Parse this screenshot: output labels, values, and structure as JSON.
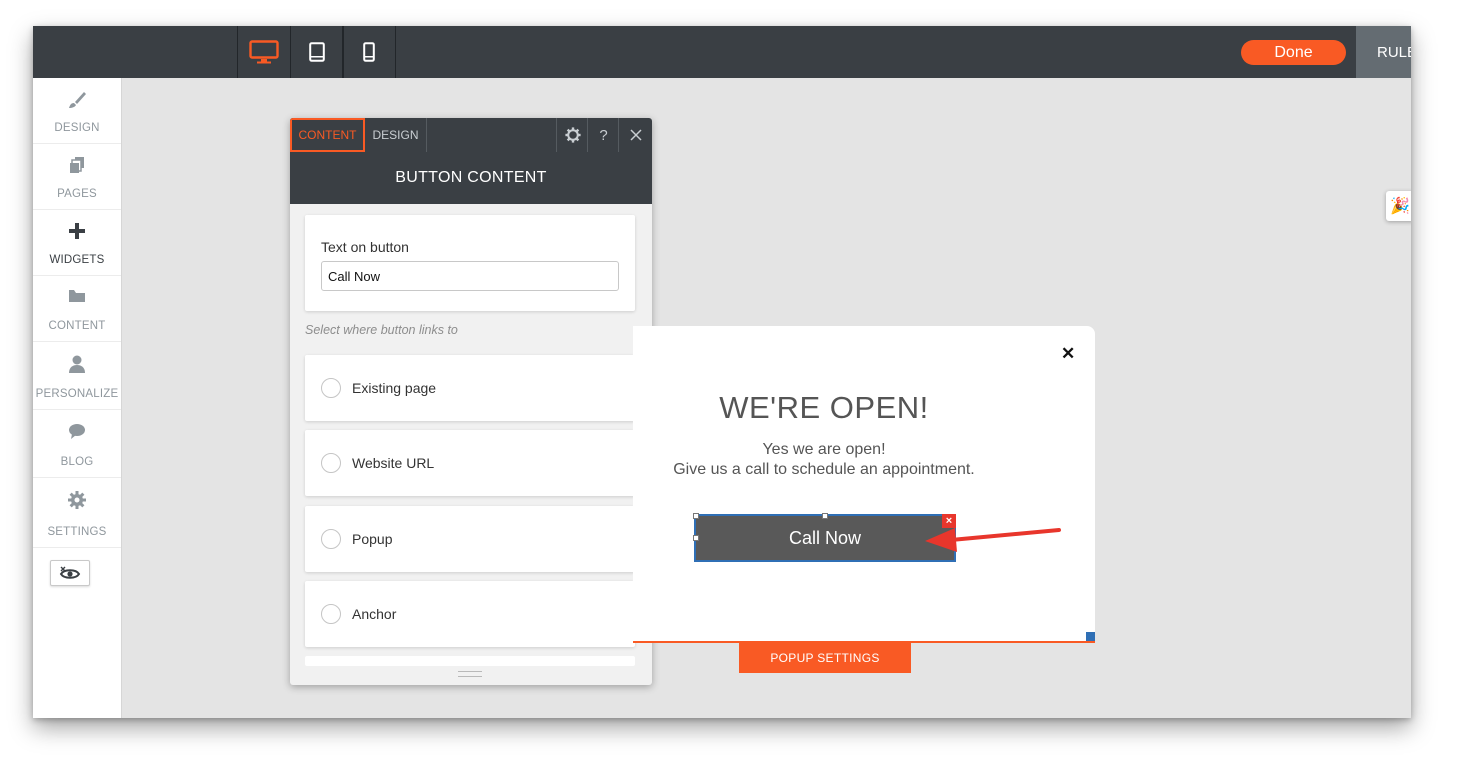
{
  "topbar": {
    "devices": [
      {
        "name": "desktop",
        "icon": "monitor-icon",
        "active": true
      },
      {
        "name": "tablet",
        "icon": "tablet-icon",
        "active": false
      },
      {
        "name": "mobile",
        "icon": "phone-icon",
        "active": false
      }
    ],
    "done_label": "Done",
    "rules_label": "RULE"
  },
  "sidebar": {
    "items": [
      {
        "label": "DESIGN",
        "icon": "brush-icon"
      },
      {
        "label": "PAGES",
        "icon": "pages-icon"
      },
      {
        "label": "WIDGETS",
        "icon": "plus-icon",
        "active": true
      },
      {
        "label": "CONTENT",
        "icon": "folder-icon"
      },
      {
        "label": "PERSONALIZE",
        "icon": "person-icon"
      },
      {
        "label": "BLOG",
        "icon": "chat-bubble-icon"
      },
      {
        "label": "SETTINGS",
        "icon": "gear-icon"
      }
    ],
    "preview_icon": "eye-icon"
  },
  "panel": {
    "tabs": [
      {
        "label": "CONTENT",
        "active": true
      },
      {
        "label": "DESIGN",
        "active": false
      }
    ],
    "title": "BUTTON CONTENT",
    "text_on_button_label": "Text on button",
    "text_on_button_value": "Call Now",
    "link_hint": "Select where button links to",
    "link_options": [
      "Existing page",
      "Website URL",
      "Popup",
      "Anchor"
    ]
  },
  "popup": {
    "close_glyph": "✕",
    "heading": "WE'RE OPEN!",
    "line1": "Yes we are open!",
    "line2": "Give us a call to schedule an appointment.",
    "button_label": "Call Now",
    "settings_label": "POPUP SETTINGS"
  },
  "colors": {
    "accent": "#f95a24",
    "topbar": "#3a3f44",
    "annotation_arrow": "#e8362c",
    "selection": "#2f6fb5"
  }
}
